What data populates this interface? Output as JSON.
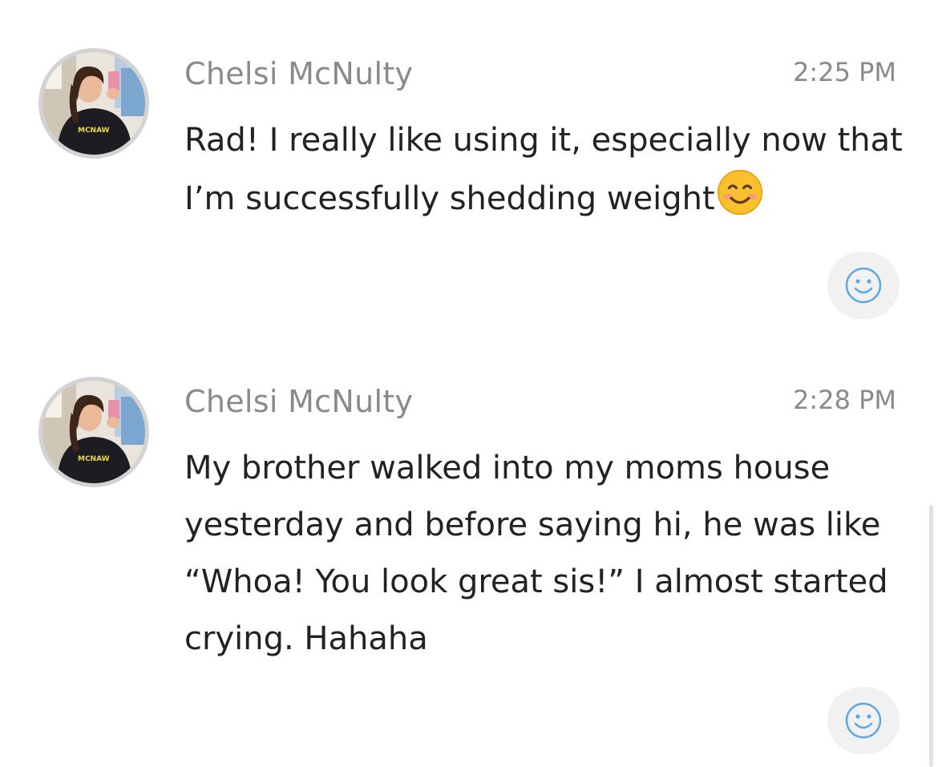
{
  "messages": [
    {
      "sender": "Chelsi McNulty",
      "time": "2:25 PM",
      "text": "Rad! I really like using it, especially now that I’m successfully shedding weight",
      "inline_emoji": "smiling-face-emoji",
      "avatar": "user-photo",
      "reaction_icon": "add-reaction-smiley-icon"
    },
    {
      "sender": "Chelsi McNulty",
      "time": "2:28 PM",
      "text": "My brother walked into my moms house yesterday and before saying hi, he was like “Whoa! You look great sis!” I almost started crying. Hahaha",
      "avatar": "user-photo",
      "reaction_icon": "add-reaction-smiley-icon"
    }
  ],
  "colors": {
    "meta_text": "#8a8a8a",
    "body_text": "#222222",
    "reaction_bg": "#f1f1f1",
    "reaction_icon": "#5aa9e6",
    "avatar_ring": "#d3d3d3"
  }
}
